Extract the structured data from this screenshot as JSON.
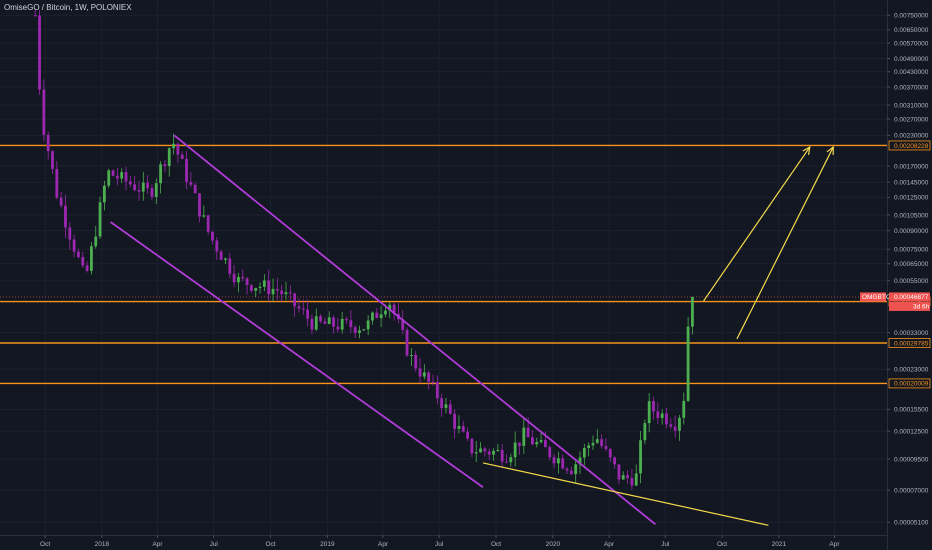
{
  "header": {
    "title": "OmiseGO / Bitcoin, 1W, POLONIEX"
  },
  "chart_data": {
    "type": "candlestick",
    "title": "OmiseGO / Bitcoin, 1W, POLONIEX",
    "symbol": "OMGBTC",
    "timeframe": "1W",
    "exchange": "POLONIEX",
    "y_scale": "log",
    "ylim": [
      4.5e-05,
      0.0079
    ],
    "price_ticks": [
      "0.00750000",
      "0.00650000",
      "0.00570000",
      "0.00490000",
      "0.00430000",
      "0.00370000",
      "0.00310000",
      "0.00270000",
      "0.00230000",
      "0.00170000",
      "0.00145000",
      "0.00125000",
      "0.00105000",
      "0.00090000",
      "0.00075000",
      "0.00065000",
      "0.00055000",
      "0.00033000",
      "0.00023000",
      "0.00015500",
      "0.00012500",
      "0.00009500",
      "0.00007000",
      "0.00005100"
    ],
    "time_ticks": [
      "Oct",
      "2018",
      "Apr",
      "Jul",
      "Oct",
      "2019",
      "Apr",
      "Jul",
      "Oct",
      "2020",
      "Apr",
      "Jul",
      "Oct",
      "2021",
      "Apr"
    ],
    "colors": {
      "up": "#4caf50",
      "down": "#9c27b0",
      "level": "#f7931a",
      "channel": "#b03cd8",
      "projection": "#f5d94b",
      "background": "#131722"
    },
    "horizontal_levels": [
      {
        "value": 0.00208228,
        "label": "0.00208228"
      },
      {
        "value": 0.00044802,
        "label": "0.00044802"
      },
      {
        "value": 0.00029785,
        "label": "0.00029785"
      },
      {
        "value": 0.00020009,
        "label": "0.00020009"
      }
    ],
    "price_tag": {
      "symbol": "OMGBTC",
      "value": "0.00046877",
      "countdown": "3d 6h"
    },
    "candles_anchor": [
      {
        "date": "2017-09-15",
        "close": 0.0075
      },
      {
        "date": "2017-09-25",
        "close": 0.0028
      },
      {
        "date": "2017-10-20",
        "close": 0.0013
      },
      {
        "date": "2017-12-05",
        "close": 0.00055
      },
      {
        "date": "2018-01-10",
        "close": 0.0016
      },
      {
        "date": "2018-03-20",
        "close": 0.0013
      },
      {
        "date": "2018-04-25",
        "close": 0.0022
      },
      {
        "date": "2018-06-25",
        "close": 0.00085
      },
      {
        "date": "2018-08-10",
        "close": 0.00055
      },
      {
        "date": "2018-10-15",
        "close": 0.0005
      },
      {
        "date": "2018-12-10",
        "close": 0.00036
      },
      {
        "date": "2019-03-05",
        "close": 0.00035
      },
      {
        "date": "2019-04-10",
        "close": 0.00046
      },
      {
        "date": "2019-05-15",
        "close": 0.00026
      },
      {
        "date": "2019-07-10",
        "close": 0.00016
      },
      {
        "date": "2019-08-20",
        "close": 0.000105
      },
      {
        "date": "2019-10-20",
        "close": 0.0001
      },
      {
        "date": "2019-11-15",
        "close": 0.00012
      },
      {
        "date": "2020-02-01",
        "close": 8.7e-05
      },
      {
        "date": "2020-03-10",
        "close": 0.00012
      },
      {
        "date": "2020-04-20",
        "close": 7.8e-05
      },
      {
        "date": "2020-05-15",
        "close": 8e-05
      },
      {
        "date": "2020-06-01",
        "close": 0.00016
      },
      {
        "date": "2020-07-20",
        "close": 0.000135
      },
      {
        "date": "2020-08-01",
        "close": 0.00018
      },
      {
        "date": "2020-08-10",
        "close": 0.0005
      },
      {
        "date": "2020-08-20",
        "close": 0.00046877
      }
    ],
    "trendlines": [
      {
        "name": "channel-upper",
        "from": {
          "date": "2018-04-28",
          "price": 0.0023
        },
        "to": {
          "date": "2020-06-15",
          "price": 5e-05
        }
      },
      {
        "name": "channel-lower",
        "from": {
          "date": "2018-01-15",
          "price": 0.00098
        },
        "to": {
          "date": "2019-09-10",
          "price": 7.2e-05
        }
      },
      {
        "name": "support-line",
        "from": {
          "date": "2019-09-10",
          "price": 9.15e-05
        },
        "to": {
          "date": "2020-12-15",
          "price": 4.95e-05
        }
      },
      {
        "name": "projection-1",
        "from": {
          "date": "2020-09-01",
          "price": 0.00045
        },
        "to": {
          "date": "2021-02-20",
          "price": 0.00205
        }
      },
      {
        "name": "projection-2",
        "from": {
          "date": "2020-10-25",
          "price": 0.00031
        },
        "to": {
          "date": "2021-03-30",
          "price": 0.00205
        }
      }
    ]
  }
}
